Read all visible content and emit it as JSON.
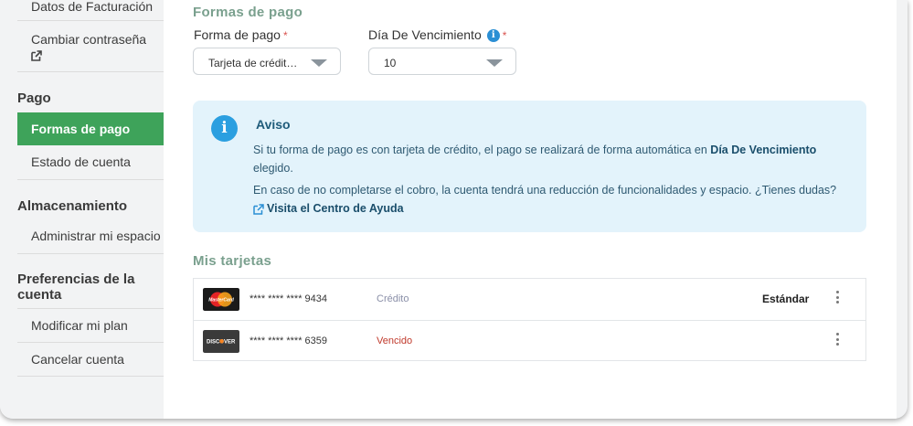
{
  "sidebar": {
    "items": [
      {
        "label": "Datos de Facturación"
      },
      {
        "label": "Cambiar contraseña"
      },
      {
        "group": "Pago"
      },
      {
        "label": "Formas de pago"
      },
      {
        "label": "Estado de cuenta"
      },
      {
        "group": "Almacenamiento"
      },
      {
        "label": "Administrar mi espacio"
      },
      {
        "group": "Preferencias de la cuenta"
      },
      {
        "label": "Modificar mi plan"
      },
      {
        "label": "Cancelar cuenta"
      }
    ]
  },
  "main": {
    "section_title": "Formas de pago",
    "payment_method": {
      "label": "Forma de pago",
      "required_mark": "*",
      "value": "Tarjeta de crédit…"
    },
    "due_day": {
      "label": "Día De Vencimiento",
      "required_mark": "*",
      "info": "i",
      "value": "10"
    },
    "notice": {
      "icon": "i",
      "title": "Aviso",
      "p1_a": "Si tu forma de pago es con tarjeta de crédito, el pago se realizará de forma automática en ",
      "p1_b": "Día De Vencimiento",
      "p1_c": " elegido.",
      "p2_a": "En caso de no completarse el cobro, la cuenta tendrá una reducción de funcionalidades y espacio. ¿Tienes dudas? ",
      "p2_link": "Visita el Centro de Ayuda"
    },
    "cards_title": "Mis tarjetas",
    "cards": [
      {
        "brand_icon": "mastercard-logo",
        "brand": "MasterCard",
        "number": "**** **** **** 9434",
        "type": "Crédito",
        "type_color": "#8a8fa8",
        "default_label": "Estándar"
      },
      {
        "brand_icon": "discover-logo",
        "brand": "DISCOVER",
        "number": "**** **** **** 6359",
        "type": "Vencido",
        "type_color": "#c0392b",
        "default_label": ""
      }
    ]
  },
  "colors": {
    "accent": "#3ea35a",
    "notice_bg": "#e3f3fb",
    "info": "#2b9fe0",
    "section_title": "#7aa08e"
  }
}
